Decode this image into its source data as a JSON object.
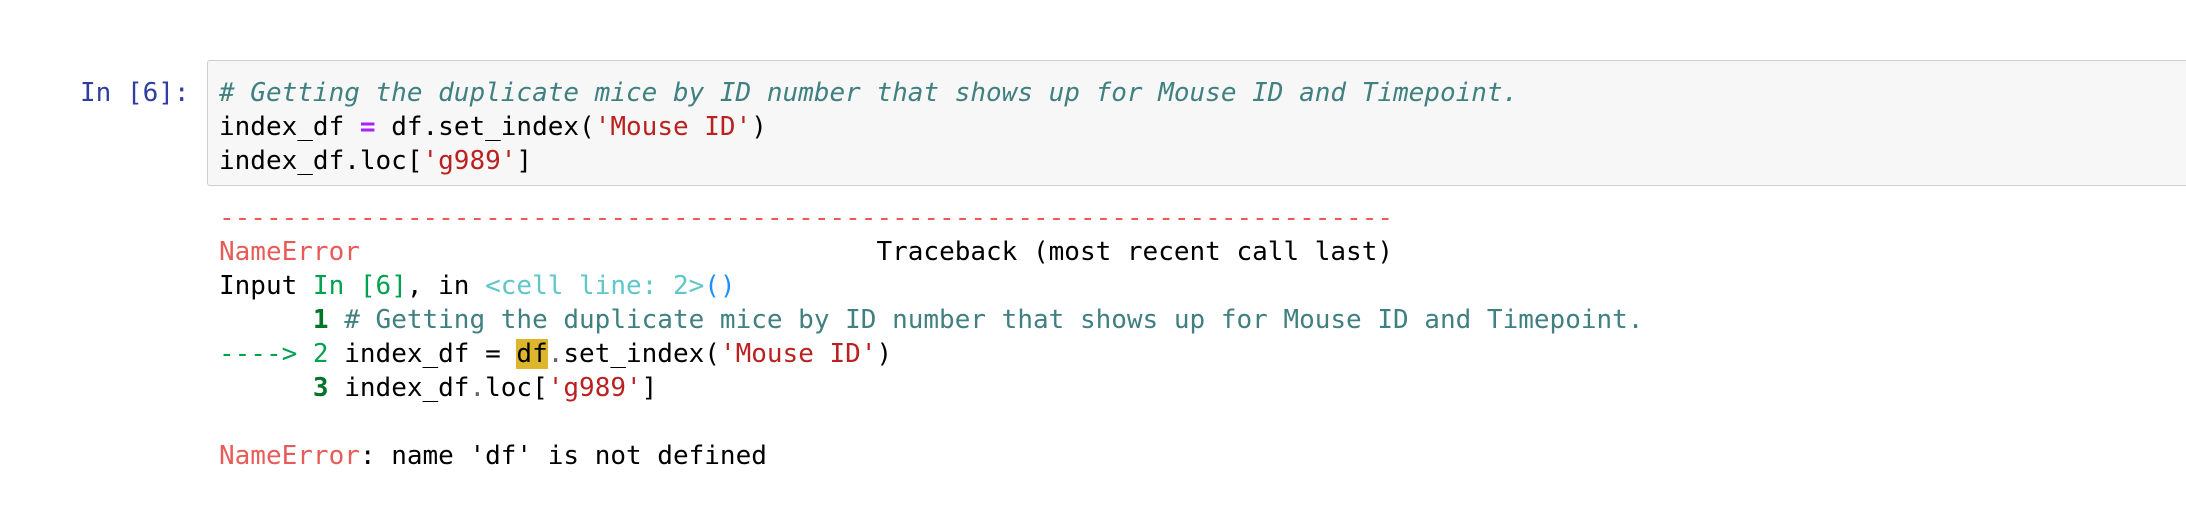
{
  "cell": {
    "prompt": "In [6]:",
    "code": {
      "line1_comment": "# Getting the duplicate mice by ID number that shows up for Mouse ID and Timepoint.",
      "line2_a": "index_df ",
      "line2_op": "=",
      "line2_b": " df.set_index(",
      "line2_str": "'Mouse ID'",
      "line2_c": ")",
      "line3_a": "index_df.loc[",
      "line3_str": "'g989'",
      "line3_c": "]"
    }
  },
  "output": {
    "dashes": "---------------------------------------------------------------------------",
    "error_name": "NameError",
    "header_spacer": "                                 ",
    "traceback_label": "Traceback (most recent call last)",
    "input_label": "Input ",
    "input_ref": "In [6]",
    "input_sep": ", in ",
    "input_loc": "<cell line: 2>",
    "input_parens": "()",
    "tb1_indent": "      ",
    "tb1_num": "1",
    "tb1_text": " # Getting the duplicate mice by ID number that shows up for Mouse ID and Timepoint.",
    "tb2_arrow": "----> 2",
    "tb2_a": " index_df = ",
    "tb2_hl": "df",
    "tb2_dot": ".",
    "tb2_b": "set_index(",
    "tb2_str": "'Mouse ID'",
    "tb2_c": ")",
    "tb3_indent": "      ",
    "tb3_num": "3",
    "tb3_a": " index_df",
    "tb3_dot": ".",
    "tb3_b": "loc[",
    "tb3_str": "'g989'",
    "tb3_c": "]",
    "final_error_name": "NameError",
    "final_message": ": name 'df' is not defined"
  }
}
